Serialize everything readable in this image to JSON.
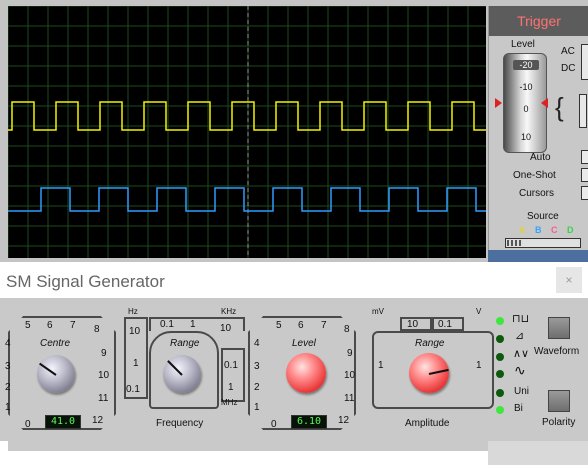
{
  "scope": {
    "trigger_title": "Trigger",
    "level_label": "Level",
    "level_scale": [
      "-20",
      "-10",
      "0",
      "10"
    ],
    "ac_label": "AC",
    "dc_label": "DC",
    "auto_label": "Auto",
    "oneshot_label": "One-Shot",
    "cursors_label": "Cursors",
    "source_label": "Source",
    "sources": [
      {
        "label": "A",
        "color": "#e0d23a"
      },
      {
        "label": "B",
        "color": "#3aa0ff"
      },
      {
        "label": "C",
        "color": "#ff5a8a"
      },
      {
        "label": "D",
        "color": "#3ad24a"
      }
    ],
    "traces": {
      "yellow": "#f2f200",
      "blue": "#2f9cff"
    }
  },
  "generator": {
    "window_title": "SM Signal Generator",
    "close_label": "×",
    "centre": {
      "label": "Centre",
      "scale": [
        "0",
        "1",
        "2",
        "3",
        "4",
        "5",
        "6",
        "7",
        "8",
        "9",
        "10",
        "11",
        "12"
      ],
      "display": "41.0"
    },
    "freq_range": {
      "label": "Range",
      "units_left": "Hz",
      "units_right": "KHz",
      "units_bottom": "MHz",
      "left_scale": [
        "10",
        "1",
        "0.1"
      ],
      "top_scale": [
        "0.1",
        "1",
        "10"
      ],
      "right_scale": [
        "0.1",
        "1"
      ]
    },
    "frequency_caption": "Frequency",
    "level": {
      "label": "Level",
      "scale": [
        "0",
        "1",
        "2",
        "3",
        "4",
        "5",
        "6",
        "7",
        "8",
        "9",
        "10",
        "11",
        "12"
      ],
      "display": "6.10"
    },
    "amp_range": {
      "label": "Range",
      "units_left": "mV",
      "units_right": "V",
      "top_scale": [
        "10",
        "0.1"
      ],
      "left_scale": [
        "1"
      ],
      "right_scale": [
        "1"
      ]
    },
    "amplitude_caption": "Amplitude",
    "waveform_label": "Waveform",
    "uni_label": "Uni",
    "bi_label": "Bi",
    "polarity_label": "Polarity",
    "waveforms": [
      {
        "icon": "square-wave-icon",
        "glyph": "⊓⊔",
        "active": true
      },
      {
        "icon": "sawtooth-wave-icon",
        "glyph": "⊿",
        "active": false
      },
      {
        "icon": "triangle-wave-icon",
        "glyph": "∧∨",
        "active": false
      },
      {
        "icon": "sine-wave-icon",
        "glyph": "∿",
        "active": false
      }
    ],
    "led_on": "#3ee63e",
    "led_off": "#0d5a0d"
  }
}
